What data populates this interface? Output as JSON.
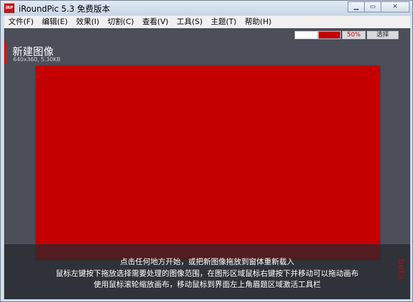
{
  "window": {
    "icon_label": "iRP",
    "title": "iRoundPic 5.3 免费版本",
    "buttons": {
      "minimize": "▁",
      "maximize": "▭",
      "close": "✕"
    }
  },
  "menu": [
    {
      "label": "文件(F)"
    },
    {
      "label": "编辑(E)"
    },
    {
      "label": "效果(I)"
    },
    {
      "label": "切割(C)"
    },
    {
      "label": "查看(V)"
    },
    {
      "label": "工具(S)"
    },
    {
      "label": "主题(T)"
    },
    {
      "label": "帮助(H)"
    }
  ],
  "toolbar": {
    "zoom": "50%",
    "select_label": "选择",
    "colors": {
      "background": "#ffffff",
      "foreground": "#c40000"
    }
  },
  "image": {
    "title": "新建图像",
    "info": "640x360, 5.30KB",
    "fill_color": "#c40000"
  },
  "hints": [
    "点击任何地方开始，或把新图像拖放到窗体重新载入",
    "鼠标左键按下拖放选择需要处理的图像范围，在图形区域鼠标右键按下并移动可以拖动画布",
    "使用鼠标滚轮缩放画布，移动鼠标到界面左上角眉题区域激活工具栏"
  ],
  "badge": "beta"
}
